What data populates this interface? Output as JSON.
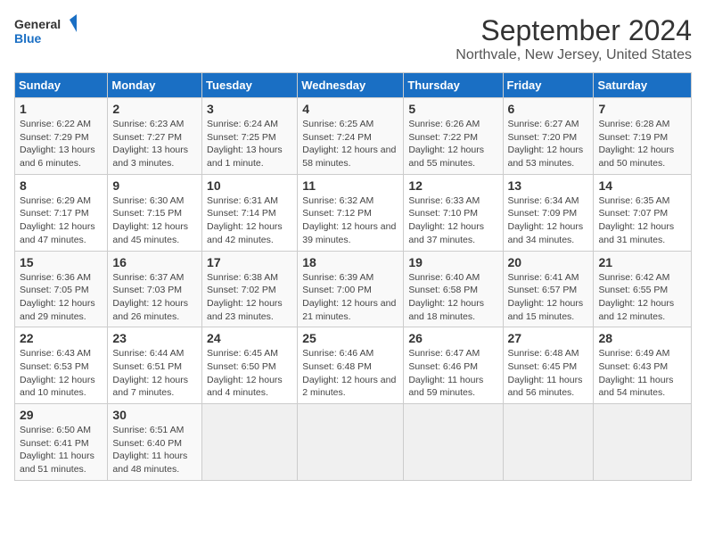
{
  "logo": {
    "line1": "General",
    "line2": "Blue"
  },
  "title": "September 2024",
  "subtitle": "Northvale, New Jersey, United States",
  "days_of_week": [
    "Sunday",
    "Monday",
    "Tuesday",
    "Wednesday",
    "Thursday",
    "Friday",
    "Saturday"
  ],
  "weeks": [
    [
      {
        "day": "1",
        "sunrise": "6:22 AM",
        "sunset": "7:29 PM",
        "daylight": "13 hours and 6 minutes."
      },
      {
        "day": "2",
        "sunrise": "6:23 AM",
        "sunset": "7:27 PM",
        "daylight": "13 hours and 3 minutes."
      },
      {
        "day": "3",
        "sunrise": "6:24 AM",
        "sunset": "7:25 PM",
        "daylight": "13 hours and 1 minute."
      },
      {
        "day": "4",
        "sunrise": "6:25 AM",
        "sunset": "7:24 PM",
        "daylight": "12 hours and 58 minutes."
      },
      {
        "day": "5",
        "sunrise": "6:26 AM",
        "sunset": "7:22 PM",
        "daylight": "12 hours and 55 minutes."
      },
      {
        "day": "6",
        "sunrise": "6:27 AM",
        "sunset": "7:20 PM",
        "daylight": "12 hours and 53 minutes."
      },
      {
        "day": "7",
        "sunrise": "6:28 AM",
        "sunset": "7:19 PM",
        "daylight": "12 hours and 50 minutes."
      }
    ],
    [
      {
        "day": "8",
        "sunrise": "6:29 AM",
        "sunset": "7:17 PM",
        "daylight": "12 hours and 47 minutes."
      },
      {
        "day": "9",
        "sunrise": "6:30 AM",
        "sunset": "7:15 PM",
        "daylight": "12 hours and 45 minutes."
      },
      {
        "day": "10",
        "sunrise": "6:31 AM",
        "sunset": "7:14 PM",
        "daylight": "12 hours and 42 minutes."
      },
      {
        "day": "11",
        "sunrise": "6:32 AM",
        "sunset": "7:12 PM",
        "daylight": "12 hours and 39 minutes."
      },
      {
        "day": "12",
        "sunrise": "6:33 AM",
        "sunset": "7:10 PM",
        "daylight": "12 hours and 37 minutes."
      },
      {
        "day": "13",
        "sunrise": "6:34 AM",
        "sunset": "7:09 PM",
        "daylight": "12 hours and 34 minutes."
      },
      {
        "day": "14",
        "sunrise": "6:35 AM",
        "sunset": "7:07 PM",
        "daylight": "12 hours and 31 minutes."
      }
    ],
    [
      {
        "day": "15",
        "sunrise": "6:36 AM",
        "sunset": "7:05 PM",
        "daylight": "12 hours and 29 minutes."
      },
      {
        "day": "16",
        "sunrise": "6:37 AM",
        "sunset": "7:03 PM",
        "daylight": "12 hours and 26 minutes."
      },
      {
        "day": "17",
        "sunrise": "6:38 AM",
        "sunset": "7:02 PM",
        "daylight": "12 hours and 23 minutes."
      },
      {
        "day": "18",
        "sunrise": "6:39 AM",
        "sunset": "7:00 PM",
        "daylight": "12 hours and 21 minutes."
      },
      {
        "day": "19",
        "sunrise": "6:40 AM",
        "sunset": "6:58 PM",
        "daylight": "12 hours and 18 minutes."
      },
      {
        "day": "20",
        "sunrise": "6:41 AM",
        "sunset": "6:57 PM",
        "daylight": "12 hours and 15 minutes."
      },
      {
        "day": "21",
        "sunrise": "6:42 AM",
        "sunset": "6:55 PM",
        "daylight": "12 hours and 12 minutes."
      }
    ],
    [
      {
        "day": "22",
        "sunrise": "6:43 AM",
        "sunset": "6:53 PM",
        "daylight": "12 hours and 10 minutes."
      },
      {
        "day": "23",
        "sunrise": "6:44 AM",
        "sunset": "6:51 PM",
        "daylight": "12 hours and 7 minutes."
      },
      {
        "day": "24",
        "sunrise": "6:45 AM",
        "sunset": "6:50 PM",
        "daylight": "12 hours and 4 minutes."
      },
      {
        "day": "25",
        "sunrise": "6:46 AM",
        "sunset": "6:48 PM",
        "daylight": "12 hours and 2 minutes."
      },
      {
        "day": "26",
        "sunrise": "6:47 AM",
        "sunset": "6:46 PM",
        "daylight": "11 hours and 59 minutes."
      },
      {
        "day": "27",
        "sunrise": "6:48 AM",
        "sunset": "6:45 PM",
        "daylight": "11 hours and 56 minutes."
      },
      {
        "day": "28",
        "sunrise": "6:49 AM",
        "sunset": "6:43 PM",
        "daylight": "11 hours and 54 minutes."
      }
    ],
    [
      {
        "day": "29",
        "sunrise": "6:50 AM",
        "sunset": "6:41 PM",
        "daylight": "11 hours and 51 minutes."
      },
      {
        "day": "30",
        "sunrise": "6:51 AM",
        "sunset": "6:40 PM",
        "daylight": "11 hours and 48 minutes."
      },
      null,
      null,
      null,
      null,
      null
    ]
  ],
  "labels": {
    "sunrise": "Sunrise:",
    "sunset": "Sunset:",
    "daylight": "Daylight:"
  }
}
